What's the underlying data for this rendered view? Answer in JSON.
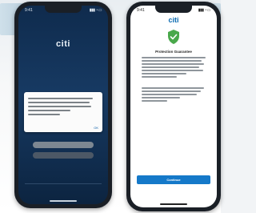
{
  "phone_left": {
    "status_time": "9:41",
    "logo": "citi",
    "dialog": {
      "ok_label": "OK"
    },
    "buttons": {
      "primary": "",
      "secondary": ""
    },
    "link": "",
    "footer": ""
  },
  "phone_right": {
    "status_time": "9:41",
    "logo": "citi",
    "title": "Protection Guarantee",
    "continue_label": "Continue",
    "link": ""
  },
  "colors": {
    "dark_bg": "#0f2b4d",
    "accent_blue": "#1579c9",
    "shield_green": "#49a84b"
  }
}
